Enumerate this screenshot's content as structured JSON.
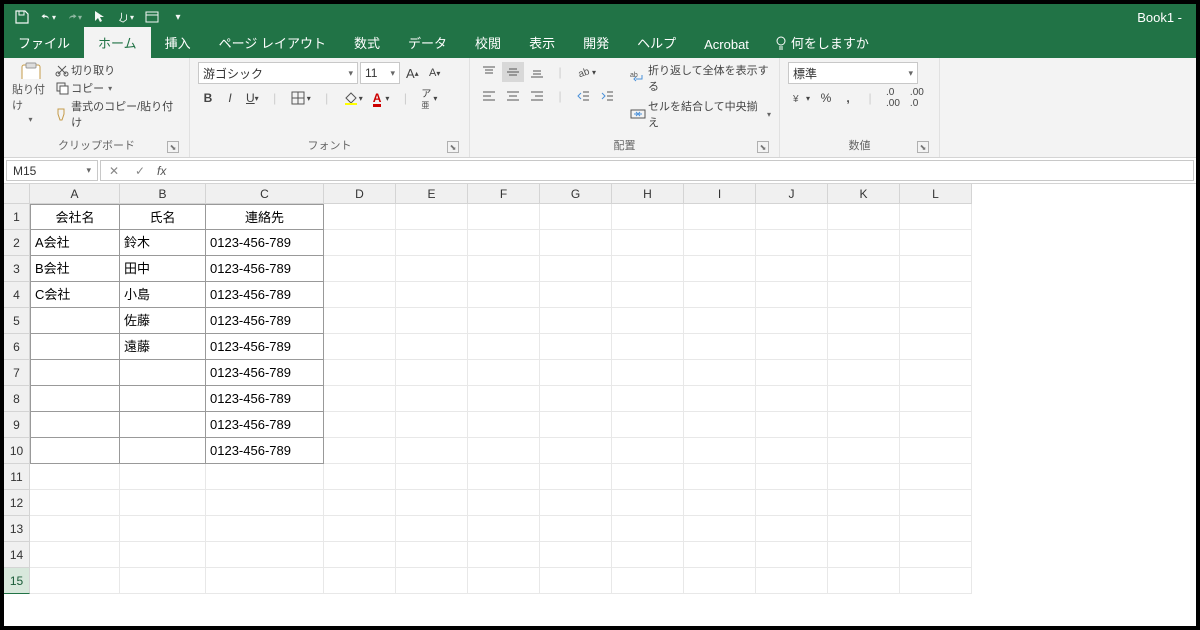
{
  "window": {
    "title": "Book1  -"
  },
  "qat": {
    "save": "save",
    "undo": "undo",
    "redo": "redo",
    "pointer": "pointer",
    "touch": "touch",
    "window": "window",
    "more": "more"
  },
  "tabs": {
    "file": "ファイル",
    "home": "ホーム",
    "insert": "挿入",
    "page_layout": "ページ レイアウト",
    "formulas": "数式",
    "data": "データ",
    "review": "校閲",
    "view": "表示",
    "developer": "開発",
    "help": "ヘルプ",
    "acrobat": "Acrobat",
    "tell": "何をしますか"
  },
  "ribbon": {
    "clipboard": {
      "paste": "貼り付け",
      "cut": "切り取り",
      "copy": "コピー",
      "format_painter": "書式のコピー/貼り付け",
      "label": "クリップボード"
    },
    "font": {
      "name": "游ゴシック",
      "size": "11",
      "label": "フォント"
    },
    "alignment": {
      "wrap": "折り返して全体を表示する",
      "merge": "セルを結合して中央揃え",
      "label": "配置"
    },
    "number": {
      "format": "標準",
      "label": "数値"
    }
  },
  "formula_bar": {
    "name_box": "M15",
    "formula": ""
  },
  "columns": [
    "A",
    "B",
    "C",
    "D",
    "E",
    "F",
    "G",
    "H",
    "I",
    "J",
    "K",
    "L"
  ],
  "col_widths": {
    "A": 90,
    "B": 86,
    "C": 118,
    "std": 72
  },
  "data_region": {
    "rows": 10,
    "cols": 3
  },
  "rows": [
    {
      "n": 1,
      "cells": [
        "会社名",
        "氏名",
        "連絡先"
      ],
      "center": true
    },
    {
      "n": 2,
      "cells": [
        "A会社",
        "鈴木",
        "0123-456-789"
      ]
    },
    {
      "n": 3,
      "cells": [
        "B会社",
        "田中",
        "0123-456-789"
      ]
    },
    {
      "n": 4,
      "cells": [
        "C会社",
        "小島",
        "0123-456-789"
      ]
    },
    {
      "n": 5,
      "cells": [
        "",
        "佐藤",
        "0123-456-789"
      ]
    },
    {
      "n": 6,
      "cells": [
        "",
        "遠藤",
        "0123-456-789"
      ]
    },
    {
      "n": 7,
      "cells": [
        "",
        "",
        "0123-456-789"
      ]
    },
    {
      "n": 8,
      "cells": [
        "",
        "",
        "0123-456-789"
      ]
    },
    {
      "n": 9,
      "cells": [
        "",
        "",
        "0123-456-789"
      ]
    },
    {
      "n": 10,
      "cells": [
        "",
        "",
        "0123-456-789"
      ]
    },
    {
      "n": 11,
      "cells": [
        "",
        "",
        ""
      ]
    },
    {
      "n": 12,
      "cells": [
        "",
        "",
        ""
      ]
    },
    {
      "n": 13,
      "cells": [
        "",
        "",
        ""
      ]
    },
    {
      "n": 14,
      "cells": [
        "",
        "",
        ""
      ]
    },
    {
      "n": 15,
      "cells": [
        "",
        "",
        ""
      ],
      "selected": true
    }
  ]
}
